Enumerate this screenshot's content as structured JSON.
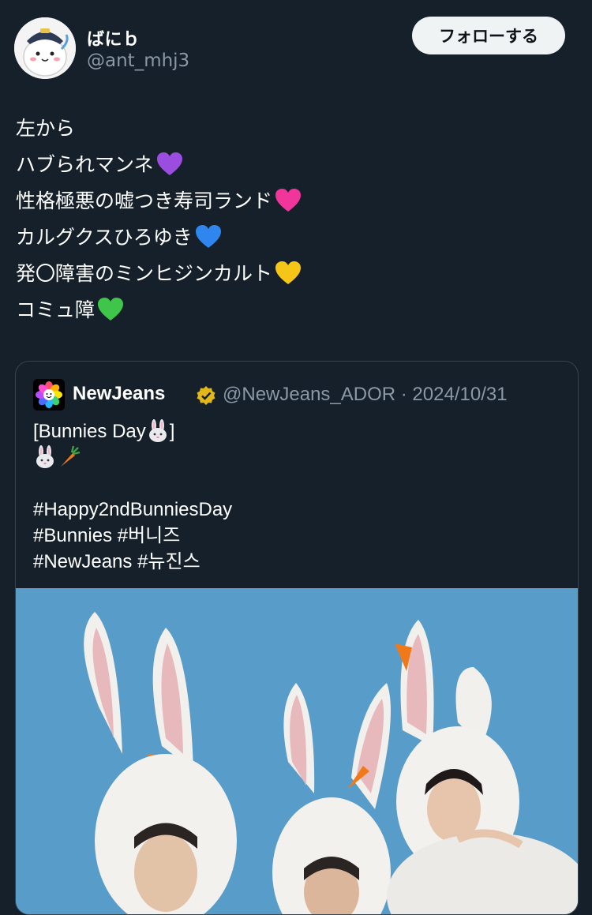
{
  "author": {
    "display_name": "ばにｂ",
    "handle": "@ant_mhj3",
    "follow_label": "フォローする"
  },
  "tweet": {
    "lines": [
      {
        "text": "左から",
        "heart": ""
      },
      {
        "text": "ハブられマンネ",
        "heart": "#9b4de0"
      },
      {
        "text": "性格極悪の嘘つき寿司ランド",
        "heart": "#f0359b"
      },
      {
        "text": "カルグクスひろゆき",
        "heart": "#2f86ee"
      },
      {
        "text": "発〇障害のミンヒジンカルト",
        "heart": "#f5c518"
      },
      {
        "text": "コミュ障",
        "heart": "#3fc54a"
      }
    ]
  },
  "quote": {
    "name": "NewJeans",
    "handle_date": "@NewJeans_ADOR · 2024/10/31",
    "line1_prefix": "[Bunnies Day",
    "line1_suffix": "]",
    "hashtags": [
      "#Happy2ndBunniesDay",
      "#Bunnies #버니즈",
      "#NewJeans #뉴진스"
    ],
    "emojis": [
      "rabbit-face",
      "carrot"
    ]
  },
  "colors": {
    "background": "#15202b",
    "border": "#38444d",
    "secondary_text": "#8b98a5",
    "verified_badge": "#e2b719",
    "photo_background": "#4f95c4"
  }
}
